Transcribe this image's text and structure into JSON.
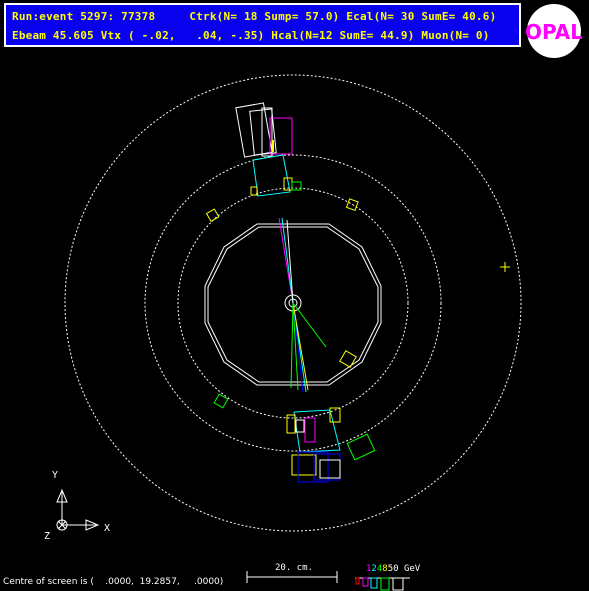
{
  "header": {
    "line1": "Run:event 5297: 77378     Ctrk(N= 18 Sump= 57.0) Ecal(N= 30 SumE= 40.6)",
    "line2": "Ebeam 45.605 Vtx ( -.02,   .04, -.35) Hcal(N=12 SumE= 44.9) Muon(N= 0)"
  },
  "logo": {
    "text": "OPAL",
    "color": "#ff00ff"
  },
  "axes": {
    "y_label": "Y",
    "x_label": "X",
    "z_label": "Z"
  },
  "scale": {
    "label": "20. cm."
  },
  "energy_legend": {
    "numbers": [
      "1",
      "2",
      "4",
      "8"
    ],
    "unit_label": "50 GeV",
    "colors": [
      "#ff00ff",
      "#00ffff",
      "#00ff00",
      "#ffff00"
    ]
  },
  "footer": {
    "centre_text": "Centre of screen is (    .0000,  19.2857,     .0000)"
  },
  "colors": {
    "background": "#000000",
    "header_bg": "#0a00f0",
    "header_text": "#ffff00"
  }
}
